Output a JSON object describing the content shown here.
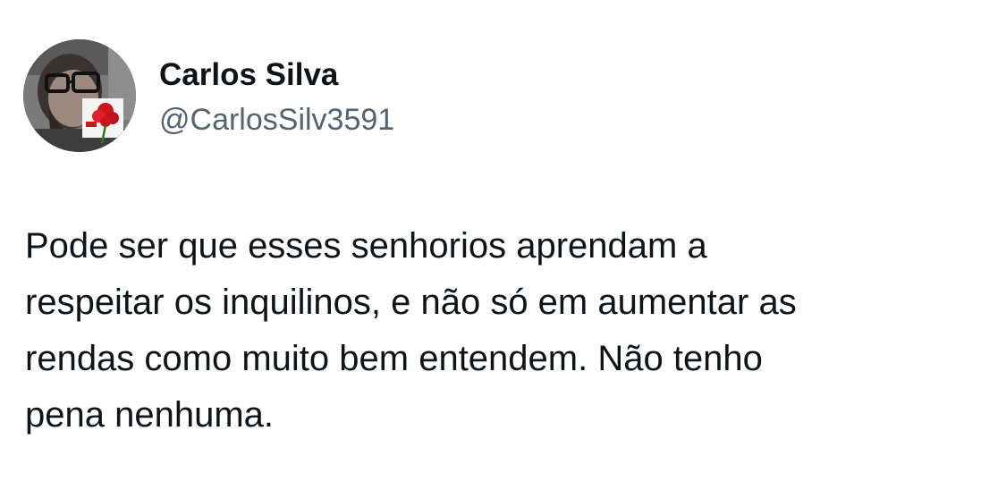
{
  "author": {
    "display_name": "Carlos Silva",
    "handle": "@CarlosSilv3591",
    "avatar_icon": "profile-photo-with-red-carnation"
  },
  "tweet": {
    "text": "Pode ser que esses senhorios aprendam a\nrespeitar os inquilinos, e não só em aumentar as\nrendas como muito bem entendem. Não tenho\npena nenhuma."
  },
  "colors": {
    "primary_text": "#0f1419",
    "secondary_text": "#536471",
    "background": "#ffffff",
    "carnation_red": "#d0141c"
  }
}
